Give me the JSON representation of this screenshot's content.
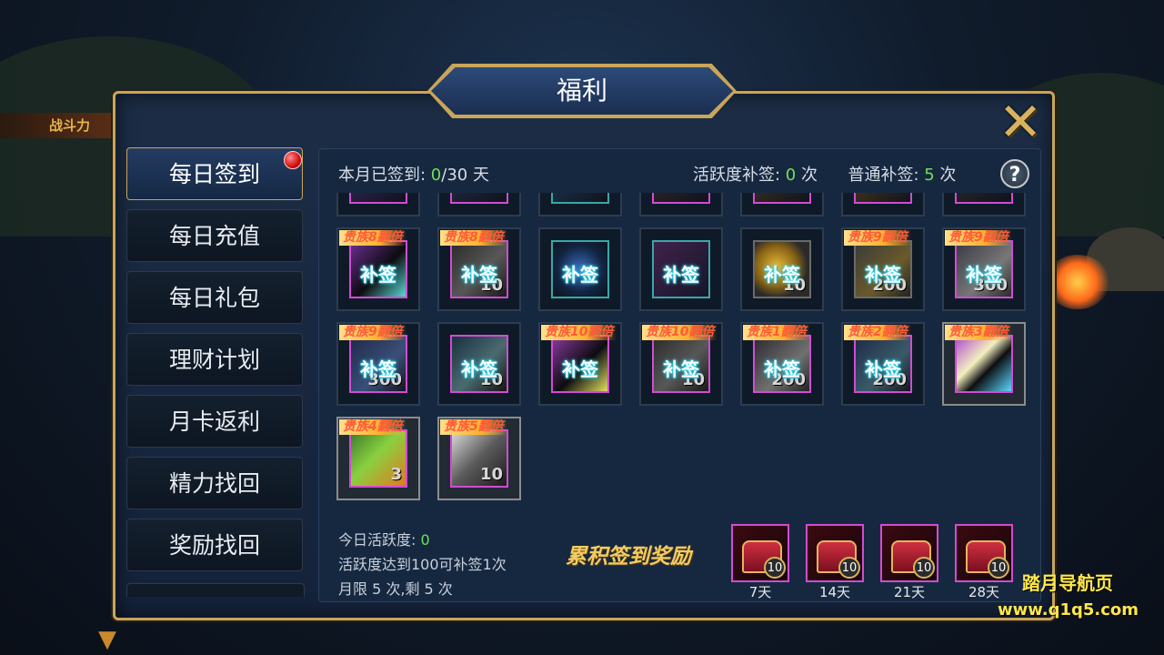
{
  "background": {
    "power_label": "战斗力"
  },
  "panel": {
    "title": "福利",
    "close_icon": "close-x-icon",
    "help_icon": "question-icon",
    "help_symbol": "?"
  },
  "sidebar": {
    "items": [
      {
        "label": "每日签到",
        "active": true,
        "notify": true
      },
      {
        "label": "每日充值",
        "active": false
      },
      {
        "label": "每日礼包",
        "active": false
      },
      {
        "label": "理财计划",
        "active": false
      },
      {
        "label": "月卡返利",
        "active": false
      },
      {
        "label": "精力找回",
        "active": false
      },
      {
        "label": "奖励找回",
        "active": false
      }
    ]
  },
  "status": {
    "signed_prefix": "本月已签到: ",
    "signed_count": "0",
    "signed_suffix": "/30 天",
    "active_prefix": "活跃度补签: ",
    "active_count": "0",
    "active_suffix": " 次",
    "normal_prefix": "普通补签: ",
    "normal_count": "5",
    "normal_suffix": " 次"
  },
  "calendar": {
    "rows": [
      [
        {
          "vip": "贵族8翻倍",
          "stamp": "补签",
          "amount": "",
          "frame": "purple"
        },
        {
          "vip": "贵族8翻倍",
          "stamp": "补签",
          "amount": "10",
          "frame": "purple"
        },
        {
          "vip": "",
          "stamp": "补签",
          "amount": "",
          "frame": "teal"
        },
        {
          "vip": "",
          "stamp": "补签",
          "amount": "",
          "frame": "teal"
        },
        {
          "vip": "",
          "stamp": "补签",
          "amount": "10",
          "frame": "gray"
        },
        {
          "vip": "贵族9翻倍",
          "stamp": "补签",
          "amount": "200",
          "frame": "gray"
        },
        {
          "vip": "贵族9翻倍",
          "stamp": "补签",
          "amount": "300",
          "frame": "purple"
        }
      ],
      [
        {
          "vip": "贵族9翻倍",
          "stamp": "补签",
          "amount": "300",
          "frame": "purple"
        },
        {
          "vip": "",
          "stamp": "补签",
          "amount": "10",
          "frame": "purple"
        },
        {
          "vip": "贵族10翻倍",
          "stamp": "补签",
          "amount": "",
          "frame": "purple"
        },
        {
          "vip": "贵族10翻倍",
          "stamp": "补签",
          "amount": "10",
          "frame": "purple"
        },
        {
          "vip": "贵族1翻倍",
          "stamp": "补签",
          "amount": "200",
          "frame": "purple"
        },
        {
          "vip": "贵族2翻倍",
          "stamp": "补签",
          "amount": "200",
          "frame": "purple"
        },
        {
          "vip": "贵族3翻倍",
          "stamp": "",
          "amount": "",
          "frame": "purple",
          "claimable": true
        }
      ],
      [
        {
          "vip": "贵族4翻倍",
          "stamp": "",
          "amount": "3",
          "frame": "purple",
          "claimable": true
        },
        {
          "vip": "贵族5翻倍",
          "stamp": "",
          "amount": "10",
          "frame": "purple",
          "claimable": true
        }
      ]
    ]
  },
  "bottom": {
    "today_prefix": "今日活跃度: ",
    "today_value": "0",
    "rule": "活跃度达到100可补签1次",
    "limit": "月限 5 次,剩 5 次",
    "cumulative_title": "累积签到奖励",
    "chests": [
      {
        "count": "10",
        "label": "7天"
      },
      {
        "count": "10",
        "label": "14天"
      },
      {
        "count": "10",
        "label": "21天"
      },
      {
        "count": "10",
        "label": "28天"
      }
    ]
  },
  "watermark": {
    "line1": "踏月导航页",
    "line2": "www.q1q5.com"
  },
  "colors": {
    "gold": "#c9a55a",
    "green": "#6ee05a",
    "purple_frame": "#d14cd3",
    "teal_frame": "#3aa7a7"
  }
}
